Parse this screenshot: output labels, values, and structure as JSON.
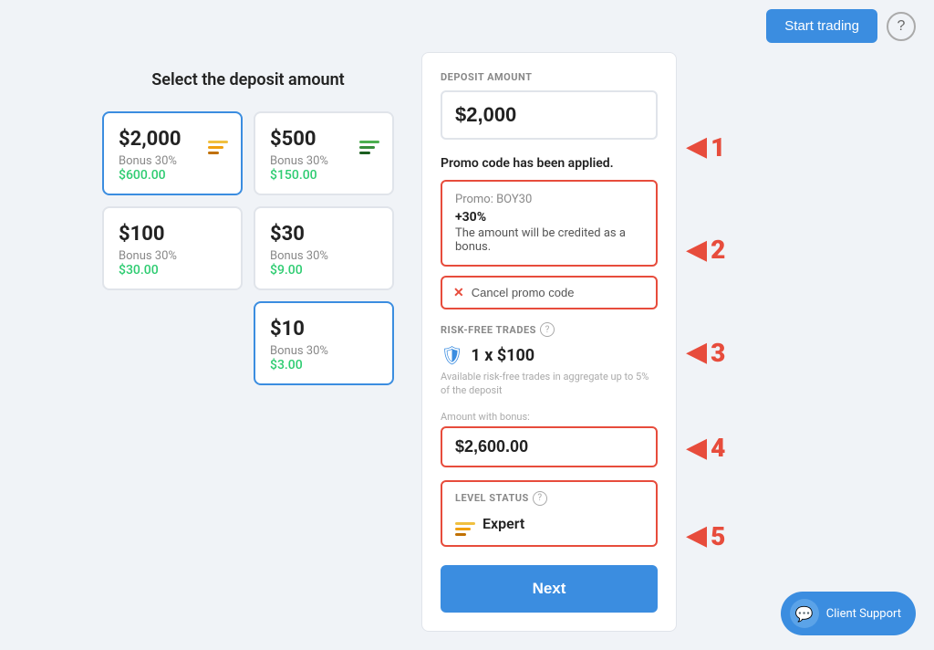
{
  "header": {
    "start_trading_label": "Start trading",
    "help_icon": "?"
  },
  "left_panel": {
    "title": "Select the deposit amount",
    "cards": [
      {
        "id": "card-2000",
        "amount": "$2,000",
        "bonus_label": "Bonus 30%",
        "bonus_value": "$600.00",
        "selected": true,
        "icon_type": "stack-gold"
      },
      {
        "id": "card-500",
        "amount": "$500",
        "bonus_label": "Bonus 30%",
        "bonus_value": "$150.00",
        "selected": false,
        "icon_type": "stack-green"
      },
      {
        "id": "card-100",
        "amount": "$100",
        "bonus_label": "Bonus 30%",
        "bonus_value": "$30.00",
        "selected": false,
        "icon_type": "none"
      },
      {
        "id": "card-30",
        "amount": "$30",
        "bonus_label": "Bonus 30%",
        "bonus_value": "$9.00",
        "selected": false,
        "icon_type": "none"
      },
      {
        "id": "card-10",
        "amount": "$10",
        "bonus_label": "Bonus 30%",
        "bonus_value": "$3.00",
        "selected": true,
        "icon_type": "none"
      }
    ]
  },
  "right_panel": {
    "deposit_amount_label": "DEPOSIT AMOUNT",
    "deposit_amount_value": "$2,000",
    "promo_applied_text": "Promo code has been applied.",
    "promo_box": {
      "code_line": "Promo: BOY30",
      "percent": "+30%",
      "description": "The amount will be credited as a bonus."
    },
    "cancel_promo_label": "Cancel promo code",
    "risk_free_label": "RISK-FREE TRADES",
    "risk_free_amount": "1 x $100",
    "risk_free_desc": "Available risk-free trades in aggregate up to 5% of the deposit",
    "amount_with_bonus_label": "Amount with bonus:",
    "amount_with_bonus_value": "$2,600.00",
    "level_status_label": "LEVEL STATUS",
    "level_status_value": "Expert",
    "next_button_label": "Next"
  },
  "annotations": [
    {
      "number": "1"
    },
    {
      "number": "2"
    },
    {
      "number": "3"
    },
    {
      "number": "4"
    },
    {
      "number": "5"
    }
  ],
  "client_support": {
    "label": "Client Support"
  }
}
